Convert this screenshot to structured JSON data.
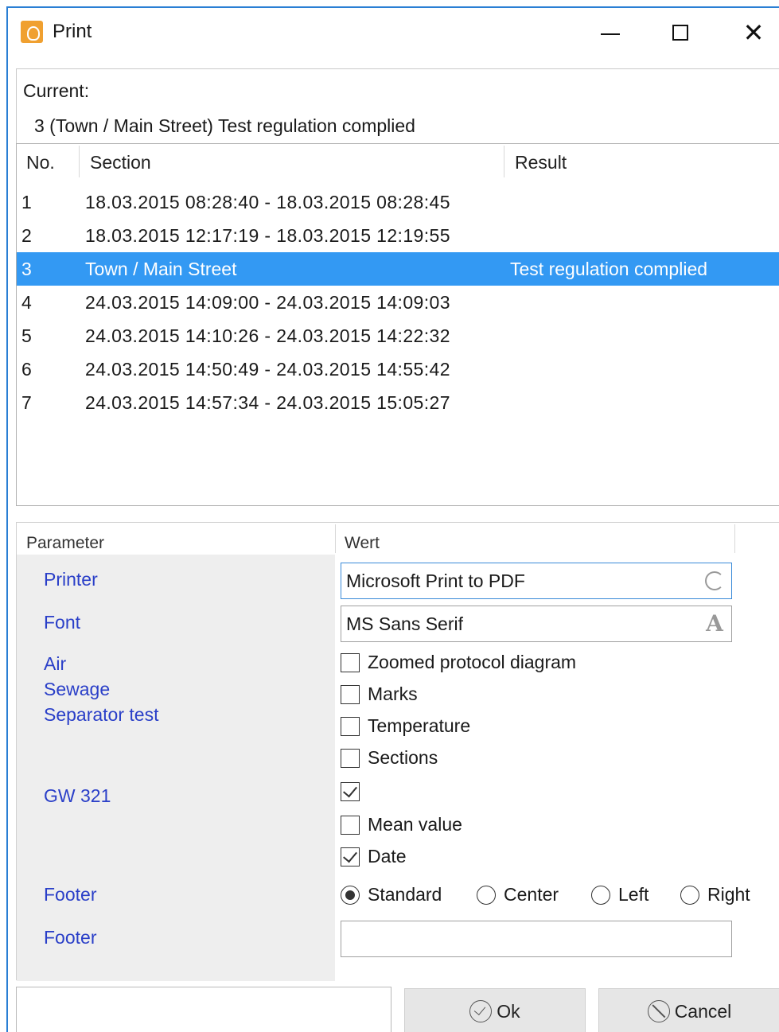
{
  "window": {
    "title": "Print",
    "minimize_symbol": "",
    "close_symbol": "✕"
  },
  "current": {
    "label": "Current:",
    "value": "3 (Town / Main Street) Test regulation complied"
  },
  "list": {
    "headers": {
      "no": "No.",
      "section": "Section",
      "result": "Result"
    },
    "rows": [
      {
        "no": "1",
        "section": "18.03.2015 08:28:40 - 18.03.2015 08:28:45",
        "result": ""
      },
      {
        "no": "2",
        "section": "18.03.2015 12:17:19 - 18.03.2015 12:19:55",
        "result": ""
      },
      {
        "no": "3",
        "section": "Town / Main Street",
        "result": "Test regulation complied",
        "selected": true
      },
      {
        "no": "4",
        "section": "24.03.2015 14:09:00 - 24.03.2015 14:09:03",
        "result": ""
      },
      {
        "no": "5",
        "section": "24.03.2015 14:10:26 - 24.03.2015 14:22:32",
        "result": ""
      },
      {
        "no": "6",
        "section": "24.03.2015 14:50:49 - 24.03.2015 14:55:42",
        "result": ""
      },
      {
        "no": "7",
        "section": "24.03.2015 14:57:34 - 24.03.2015 15:05:27",
        "result": ""
      }
    ],
    "selected_color": "#3399f3"
  },
  "params": {
    "headers": {
      "parameter": "Parameter",
      "value": "Wert"
    },
    "labels": {
      "printer": "Printer",
      "font": "Font",
      "air": "Air",
      "sewage": "Sewage",
      "separator": "Separator test",
      "gw": "GW 321",
      "footer1": "Footer",
      "footer2": "Footer"
    },
    "printer_value": "Microsoft Print to PDF",
    "printer_icon": "refresh-icon",
    "font_value": "MS Sans Serif",
    "font_icon_glyph": "A",
    "checks": {
      "zoomed": {
        "label": "Zoomed protocol diagram",
        "checked": false
      },
      "marks": {
        "label": "Marks",
        "checked": false
      },
      "temperature": {
        "label": "Temperature",
        "checked": false
      },
      "sections": {
        "label": "Sections",
        "checked": false
      },
      "gw": {
        "label": "",
        "checked": true
      },
      "mean": {
        "label": "Mean value",
        "checked": false
      },
      "date": {
        "label": "Date",
        "checked": true
      }
    },
    "footer_options": {
      "standard": "Standard",
      "center": "Center",
      "left": "Left",
      "right": "Right",
      "selected": "Standard"
    },
    "footer_text_value": "",
    "label_color": "#2a3fc8"
  },
  "buttons": {
    "ok": "Ok",
    "cancel": "Cancel"
  },
  "status_value": ""
}
